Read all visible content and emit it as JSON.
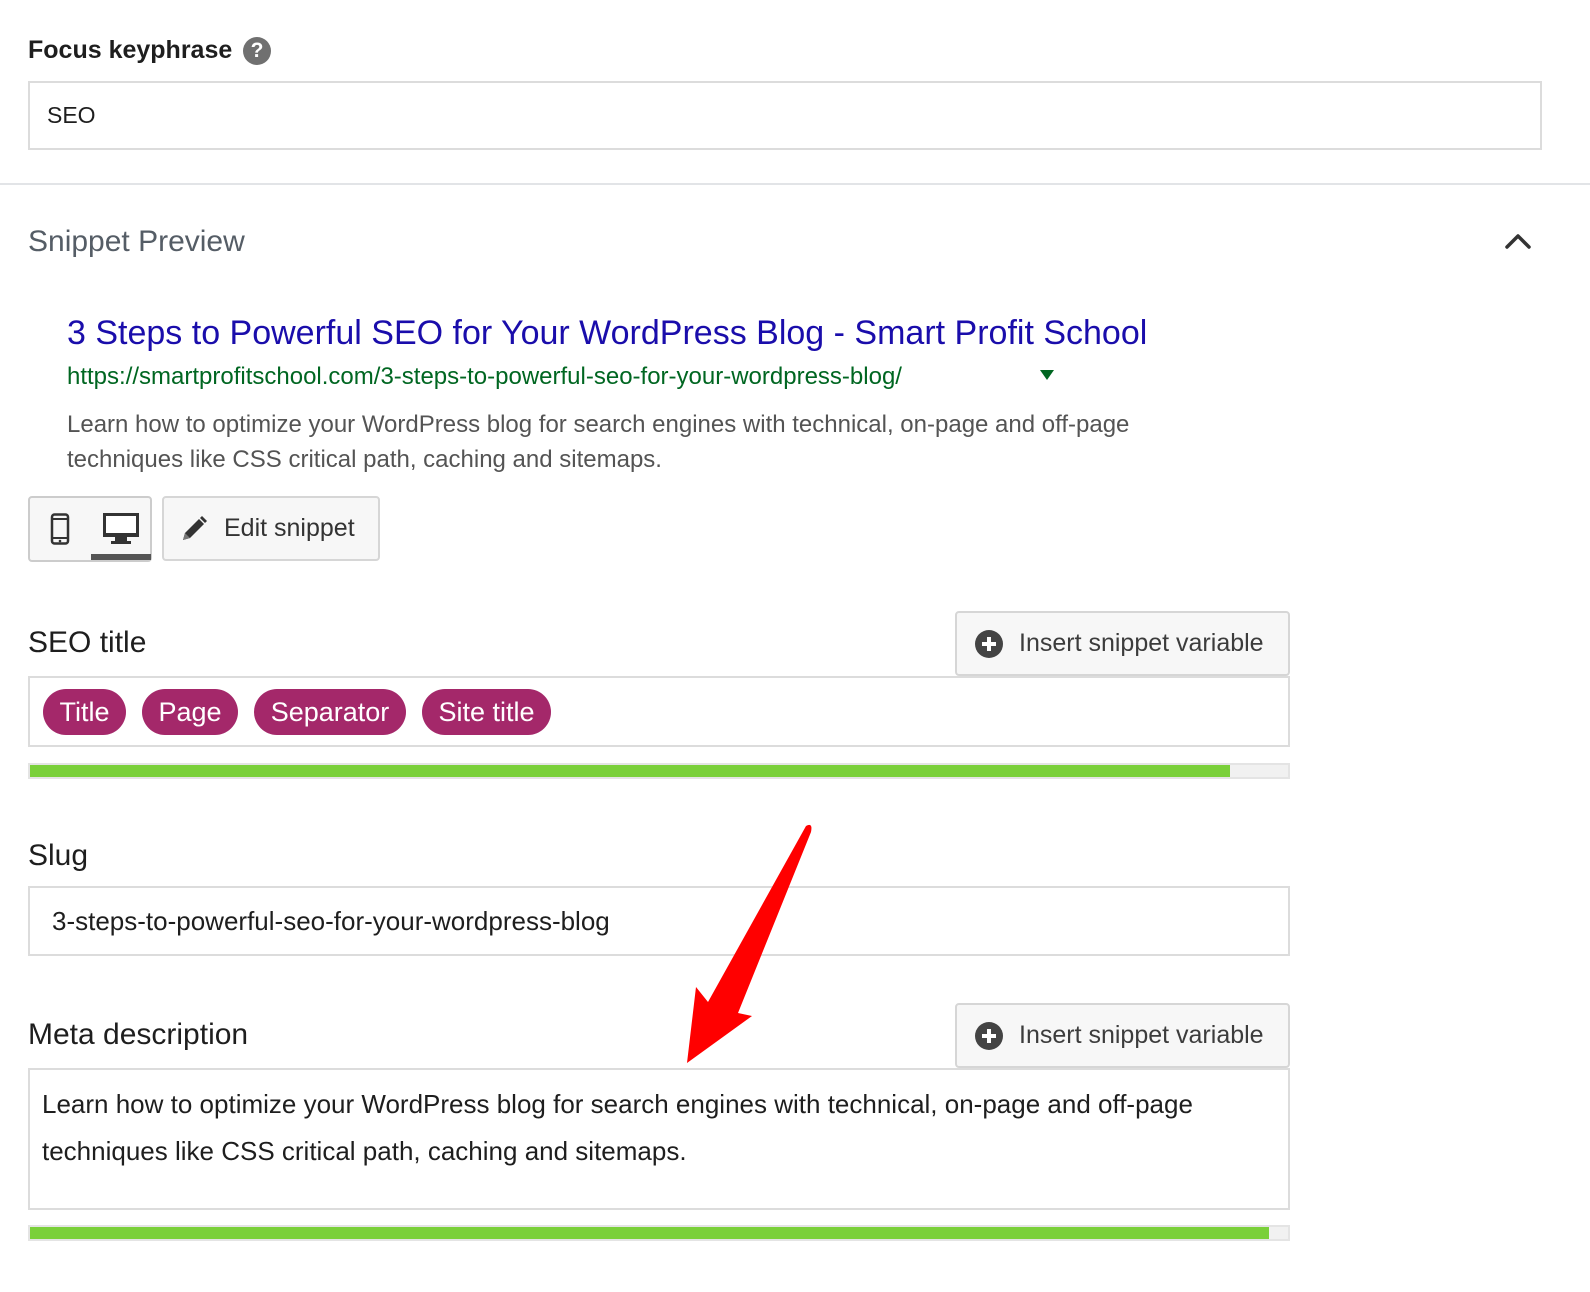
{
  "focus_keyphrase": {
    "label": "Focus keyphrase",
    "help_icon": "?",
    "value": "SEO"
  },
  "snippet_preview": {
    "heading": "Snippet Preview",
    "collapse_icon": "chevron-up-icon",
    "serp": {
      "title": "3 Steps to Powerful SEO for Your WordPress Blog - Smart Profit School",
      "url": "https://smartprofitschool.com/3-steps-to-powerful-seo-for-your-wordpress-blog/",
      "description": "Learn how to optimize your WordPress blog for search engines with technical, on-page and off-page techniques like CSS critical path, caching and sitemaps."
    },
    "mode_icons": [
      "mobile-icon",
      "desktop-icon"
    ],
    "active_mode": "desktop",
    "edit_snippet_label": "Edit snippet"
  },
  "seo_title": {
    "label": "SEO title",
    "insert_variable_label": "Insert snippet variable",
    "variables": [
      "Title",
      "Page",
      "Separator",
      "Site title"
    ],
    "progress": 0.954
  },
  "slug": {
    "label": "Slug",
    "value": "3-steps-to-powerful-seo-for-your-wordpress-blog"
  },
  "meta_description": {
    "label": "Meta description",
    "insert_variable_label": "Insert snippet variable",
    "value": "Learn how to optimize your WordPress blog for search engines with technical, on-page and off-page techniques like CSS critical path, caching and sitemaps.",
    "progress": 0.985
  },
  "colors": {
    "variable_pill": "#a4286a",
    "progress_good": "#7ad03a",
    "serp_title": "#1a0dab",
    "serp_url": "#006621",
    "annotation_arrow": "#ff0000"
  }
}
